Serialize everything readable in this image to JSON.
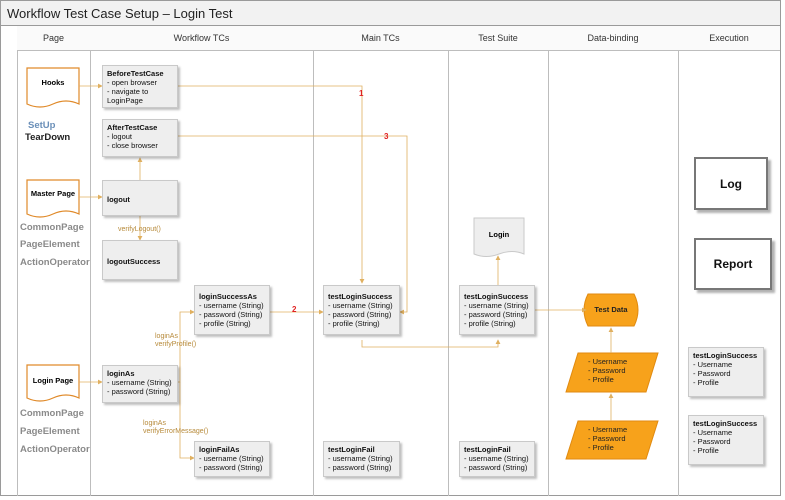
{
  "title": "Workflow Test Case Setup – Login Test",
  "lanes": [
    "Page",
    "Workflow TCs",
    "Main TCs",
    "Test Suite",
    "Data-binding",
    "Execution"
  ],
  "page_docs": {
    "hooks": "Hooks",
    "master": "Master Page",
    "login": "Login Page"
  },
  "side_labels": {
    "setup": "SetUp",
    "teardown": "TearDown",
    "common1": "CommonPage",
    "element1": "PageElement",
    "operator1": "ActionOperator",
    "common2": "CommonPage",
    "element2": "PageElement",
    "operator2": "ActionOperator"
  },
  "workflow": {
    "before": {
      "title": "BeforeTestCase",
      "lines": [
        "- open browser",
        "- navigate to",
        "LoginPage"
      ]
    },
    "after": {
      "title": "AfterTestCase",
      "lines": [
        "- logout",
        "- close browser"
      ]
    },
    "logout": {
      "title": "logout"
    },
    "logoutSuccess": {
      "title": "logoutSuccess"
    },
    "loginAs": {
      "title": "loginAs",
      "lines": [
        "- username (String)",
        "- password (String)"
      ]
    },
    "loginSuccessAs": {
      "title": "loginSuccessAs",
      "lines": [
        "- username (String)",
        "- password (String)",
        "- profile (String)"
      ]
    },
    "loginFailAs": {
      "title": "loginFailAs",
      "lines": [
        "- username (String)",
        "- password (String)"
      ]
    }
  },
  "notes": {
    "verifyLogout": "verifyLogout()",
    "verifyProfile1": "loginAs",
    "verifyProfile2": "verifyProfile()",
    "verifyError1": "loginAs",
    "verifyError2": "verifyErrorMessage()"
  },
  "main": {
    "success": {
      "title": "testLoginSuccess",
      "lines": [
        "- username (String)",
        "- password (String)",
        "- profile (String)"
      ]
    },
    "fail": {
      "title": "testLoginFail",
      "lines": [
        "- username (String)",
        "- password (String)"
      ]
    }
  },
  "suite": {
    "doc": "Login",
    "success": {
      "title": "testLoginSuccess",
      "lines": [
        "- username (String)",
        "- password (String)",
        "- profile (String)"
      ]
    },
    "fail": {
      "title": "testLoginFail",
      "lines": [
        "- username (String)",
        "- password (String)"
      ]
    }
  },
  "binding": {
    "testdata": "Test Data",
    "para1": [
      "- Username",
      "- Password",
      "- Profile"
    ],
    "para2": [
      "- Username",
      "- Password",
      "- Profile"
    ]
  },
  "execution": {
    "log": "Log",
    "report": "Report",
    "result1": {
      "title": "testLoginSuccess",
      "lines": [
        "- Username",
        "- Password",
        "- Profile"
      ]
    },
    "result2": {
      "title": "testLoginSuccess",
      "lines": [
        "- Username",
        "- Password",
        "- Profile"
      ]
    }
  },
  "markers": {
    "m1": "1",
    "m2": "2",
    "m3": "3"
  },
  "colors": {
    "accent": "#f7a21b",
    "connector": "#e0b060",
    "marker": "#e02020"
  }
}
